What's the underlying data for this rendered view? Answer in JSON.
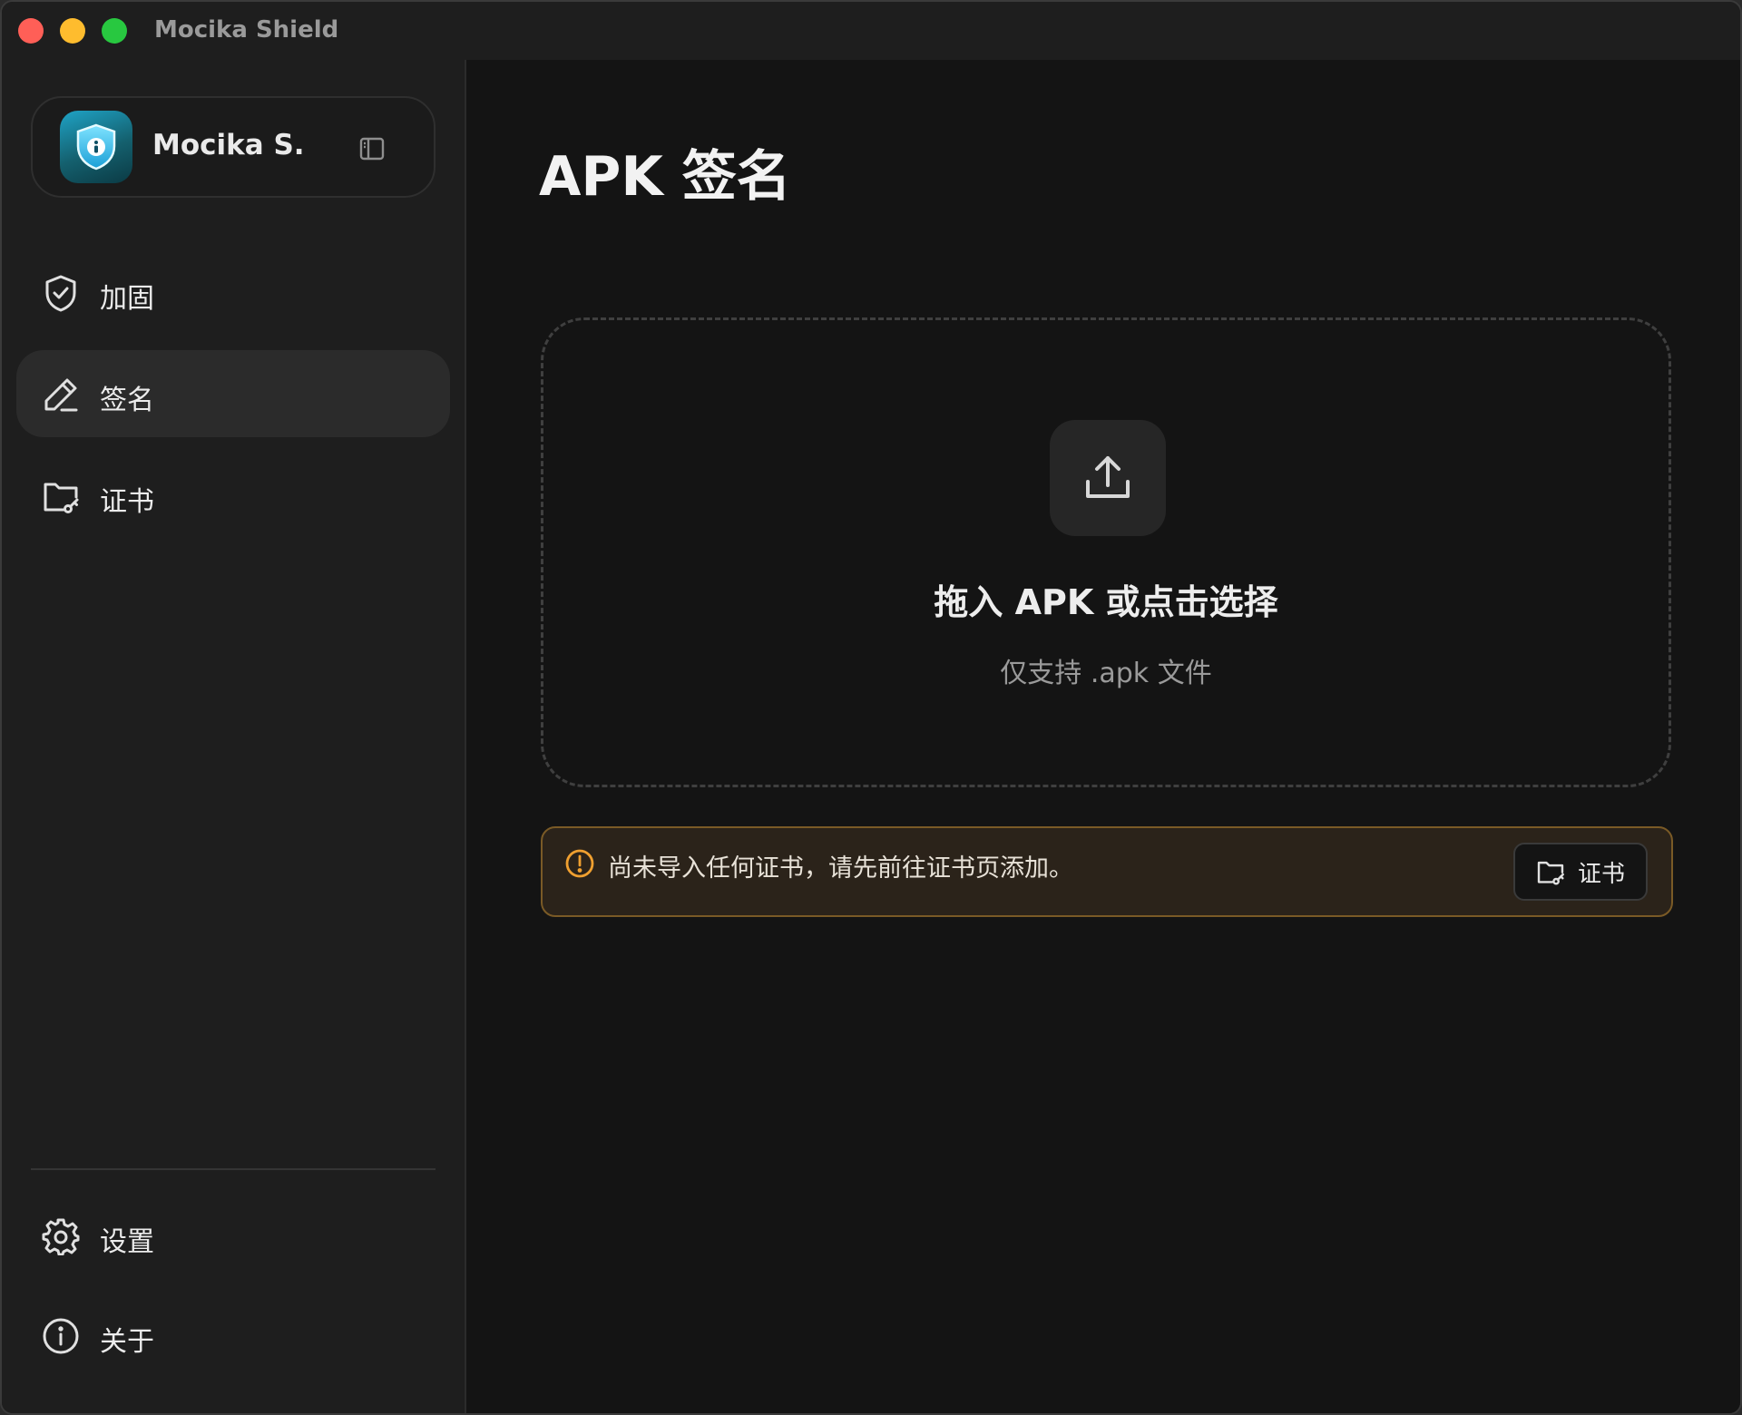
{
  "window": {
    "title": "Mocika Shield"
  },
  "sidebar": {
    "app_name": "Mocika S...",
    "logo_icon": "shield-info-icon",
    "collapse_icon": "sidebar-toggle-icon",
    "items": [
      {
        "label": "加固",
        "icon": "shield-check-icon",
        "active": false
      },
      {
        "label": "签名",
        "icon": "pen-icon",
        "active": true
      },
      {
        "label": "证书",
        "icon": "folder-key-icon",
        "active": false
      }
    ],
    "footer_items": [
      {
        "label": "设置",
        "icon": "gear-icon"
      },
      {
        "label": "关于",
        "icon": "info-icon"
      }
    ]
  },
  "main": {
    "title": "APK 签名",
    "dropzone": {
      "icon": "upload-icon",
      "title": "拖入 APK 或点击选择",
      "subtitle": "仅支持 .apk 文件"
    },
    "warning": {
      "icon": "alert-circle-icon",
      "text": "尚未导入任何证书，请先前往证书页添加。",
      "button_label": "证书",
      "button_icon": "folder-key-icon"
    }
  },
  "colors": {
    "accent_warning": "#f0a030",
    "active_item_bg": "#2b2b2b",
    "logo_gradient_top": "#1fa3c6"
  }
}
